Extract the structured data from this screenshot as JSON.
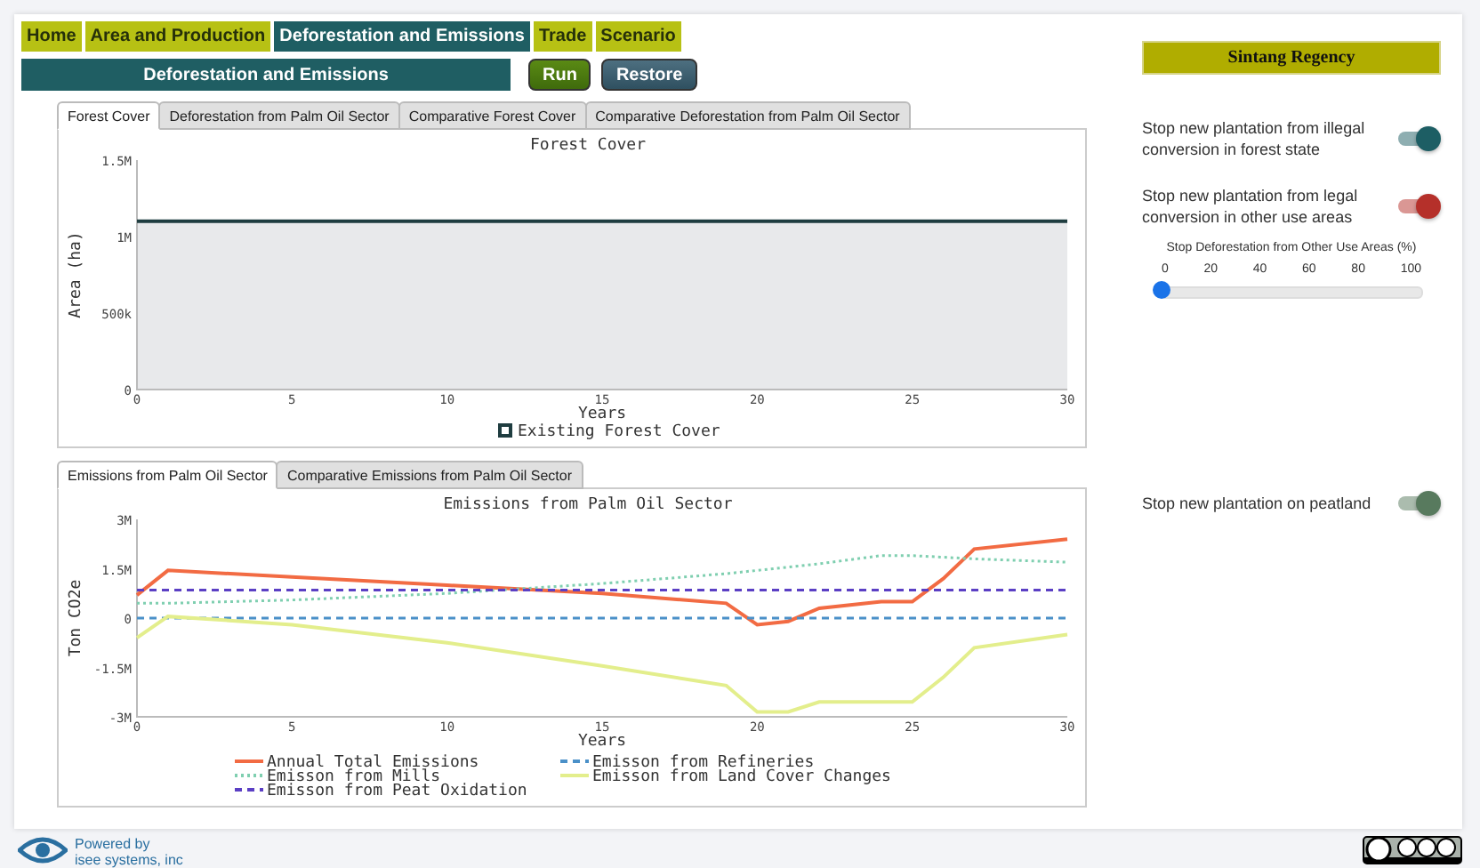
{
  "nav": [
    {
      "label": "Home",
      "selected": false
    },
    {
      "label": "Area and Production",
      "selected": false
    },
    {
      "label": "Deforestation and Emissions",
      "selected": true
    },
    {
      "label": "Trade",
      "selected": false
    },
    {
      "label": "Scenario",
      "selected": false
    }
  ],
  "page_title": "Deforestation and Emissions",
  "buttons": [
    {
      "label": "Run",
      "kind": "run"
    },
    {
      "label": "Restore",
      "kind": "restore"
    }
  ],
  "panels": [
    {
      "tabs": [
        {
          "label": "Forest Cover",
          "selected": true
        },
        {
          "label": "Deforestation from Palm Oil Sector",
          "selected": false
        },
        {
          "label": "Comparative Forest Cover",
          "selected": false
        },
        {
          "label": "Comparative Deforestation from Palm Oil Sector",
          "selected": false
        }
      ],
      "chart_data": {
        "type": "area",
        "title": "Forest Cover",
        "xlabel": "Years",
        "ylabel": "Area (ha)",
        "x": [
          0,
          30
        ],
        "xlim": [
          0,
          30
        ],
        "ylim": [
          0,
          1500000
        ],
        "legend": true,
        "xticks": [
          {
            "value": 0,
            "label": "0"
          },
          {
            "value": 5,
            "label": "5"
          },
          {
            "value": 10,
            "label": "10"
          },
          {
            "value": 15,
            "label": "15"
          },
          {
            "value": 20,
            "label": "20"
          },
          {
            "value": 25,
            "label": "25"
          },
          {
            "value": 30,
            "label": "30"
          }
        ],
        "yticks": [
          {
            "value": 0,
            "label": "0"
          },
          {
            "value": 500000,
            "label": "500k"
          },
          {
            "value": 1000000,
            "label": "1M"
          },
          {
            "value": 1500000,
            "label": "1.5M"
          }
        ],
        "series": [
          {
            "name": "Existing Forest Cover",
            "color": "#1f3d40",
            "values": [
              1100000,
              1100000
            ]
          }
        ]
      }
    },
    {
      "tabs": [
        {
          "label": "Emissions from Palm Oil Sector",
          "selected": true
        },
        {
          "label": "Comparative Emissions from Palm Oil Sector",
          "selected": false
        }
      ],
      "chart_data": {
        "type": "line",
        "title": "Emissions from Palm Oil Sector",
        "xlabel": "Years",
        "ylabel": "Ton CO2e",
        "x": [
          0,
          1,
          5,
          10,
          15,
          19,
          20,
          21,
          22,
          24,
          25,
          26,
          27,
          30
        ],
        "xlim": [
          0,
          30
        ],
        "ylim": [
          -3000000,
          3000000
        ],
        "legend": true,
        "xticks": [
          {
            "value": 0,
            "label": "0"
          },
          {
            "value": 5,
            "label": "5"
          },
          {
            "value": 10,
            "label": "10"
          },
          {
            "value": 15,
            "label": "15"
          },
          {
            "value": 20,
            "label": "20"
          },
          {
            "value": 25,
            "label": "25"
          },
          {
            "value": 30,
            "label": "30"
          }
        ],
        "yticks": [
          {
            "value": -3000000,
            "label": "-3M"
          },
          {
            "value": -1500000,
            "label": "-1.5M"
          },
          {
            "value": 0,
            "label": "0"
          },
          {
            "value": 1500000,
            "label": "1.5M"
          },
          {
            "value": 3000000,
            "label": "3M"
          }
        ],
        "series": [
          {
            "name": "Annual Total Emissions",
            "color": "#f26b43",
            "line_style": "solid",
            "values": [
              700000,
              1450000,
              1250000,
              1000000,
              750000,
              450000,
              -200000,
              -100000,
              300000,
              500000,
              500000,
              1200000,
              2100000,
              2400000
            ]
          },
          {
            "name": "Emisson from Refineries",
            "color": "#4a90c8",
            "line_style": "dashed",
            "values": [
              0,
              0,
              0,
              0,
              0,
              0,
              0,
              0,
              0,
              0,
              0,
              0,
              0,
              0
            ]
          },
          {
            "name": "Emisson from Mills",
            "color": "#7fcfb0",
            "line_style": "dotted",
            "values": [
              450000,
              450000,
              550000,
              750000,
              1050000,
              1350000,
              1450000,
              1550000,
              1650000,
              1900000,
              1900000,
              1850000,
              1800000,
              1700000
            ]
          },
          {
            "name": "Emisson from Land Cover Changes",
            "color": "#e3ee8c",
            "line_style": "solid",
            "values": [
              -600000,
              50000,
              -200000,
              -750000,
              -1450000,
              -2050000,
              -2850000,
              -2850000,
              -2550000,
              -2550000,
              -2550000,
              -1800000,
              -900000,
              -500000
            ]
          },
          {
            "name": "Emisson from Peat Oxidation",
            "color": "#5b3fc4",
            "line_style": "dashed",
            "values": [
              850000,
              850000,
              850000,
              850000,
              850000,
              850000,
              850000,
              850000,
              850000,
              850000,
              850000,
              850000,
              850000,
              850000
            ]
          }
        ]
      }
    }
  ],
  "sidebar": {
    "title": "Sintang Regency",
    "controls": [
      {
        "kind": "toggle",
        "label": "Stop new plantation from illegal conversion in forest state",
        "on": true,
        "color": "#1d5e64"
      },
      {
        "kind": "toggle",
        "label": "Stop new plantation from legal conversion in other use areas",
        "on": true,
        "color": "#b5302a"
      },
      {
        "kind": "slider",
        "label": "Stop Deforestation from Other Use Areas (%)",
        "tick_labels": [
          "0",
          "20",
          "40",
          "60",
          "80",
          "100"
        ],
        "level": 0
      },
      {
        "kind": "spacer"
      },
      {
        "kind": "toggle",
        "label": "Stop new plantation on peatland",
        "on": true,
        "color": "#587a5e"
      }
    ]
  },
  "footer": {
    "powered_by": "Powered by",
    "company": "isee systems, inc"
  }
}
